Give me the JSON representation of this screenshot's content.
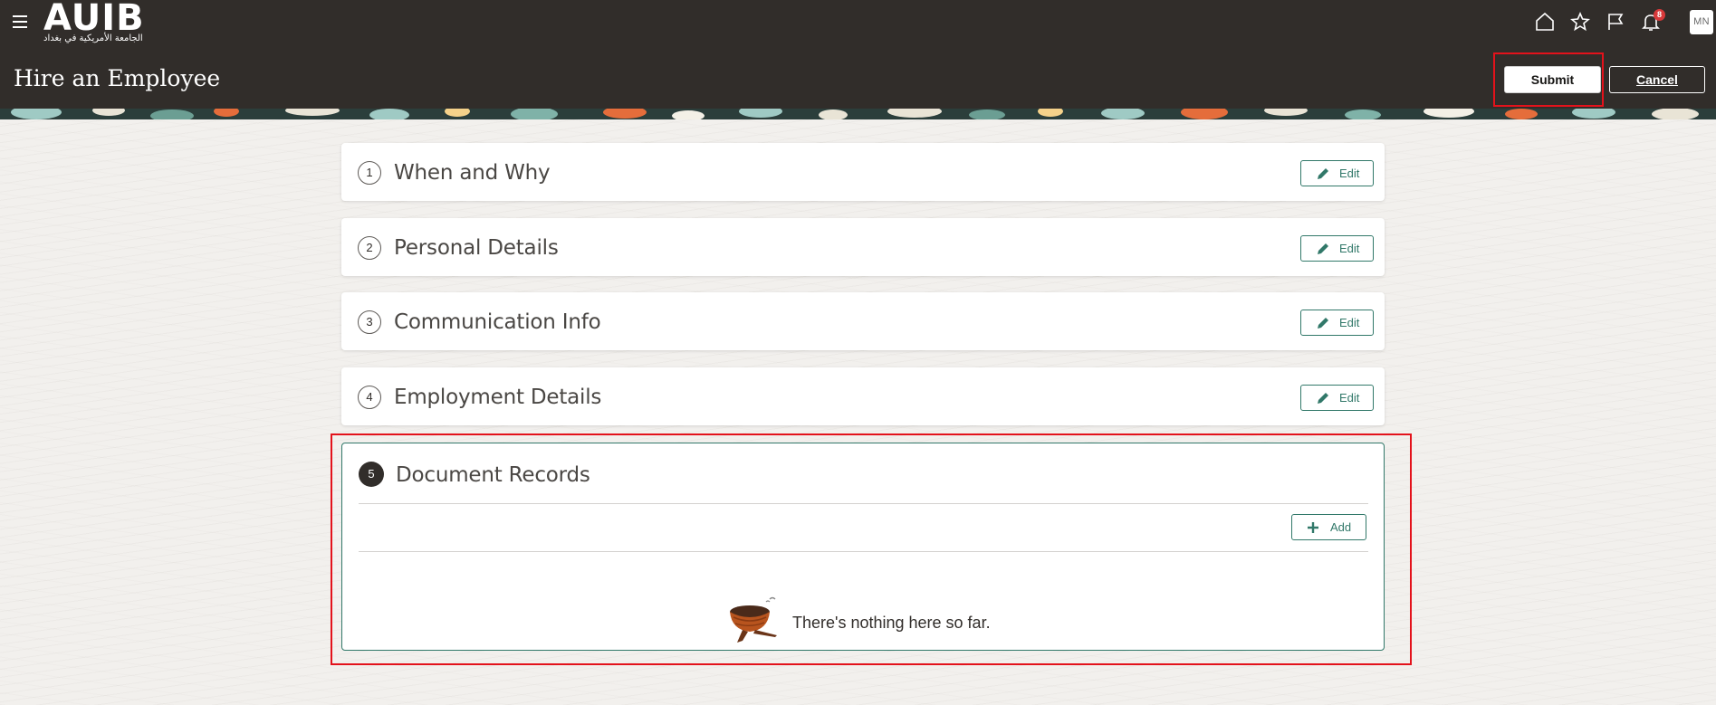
{
  "header": {
    "logo_text": "AUIB",
    "logo_subtext": "الجامعة الأمريكية في بغداد",
    "page_title": "Hire an Employee",
    "notification_count": "8",
    "avatar_initials": "MN",
    "submit_label": "Submit",
    "cancel_label": "Cancel"
  },
  "sections": [
    {
      "step": "1",
      "title": "When and Why",
      "action_label": "Edit"
    },
    {
      "step": "2",
      "title": "Personal Details",
      "action_label": "Edit"
    },
    {
      "step": "3",
      "title": "Communication Info",
      "action_label": "Edit"
    },
    {
      "step": "4",
      "title": "Employment Details",
      "action_label": "Edit"
    }
  ],
  "active_section": {
    "step": "5",
    "title": "Document Records",
    "add_label": "Add",
    "empty_message": "There's nothing here so far."
  },
  "colors": {
    "header_bg": "#312d2a",
    "accent": "#317869",
    "highlight": "#e3121b",
    "badge": "#d8393a"
  }
}
